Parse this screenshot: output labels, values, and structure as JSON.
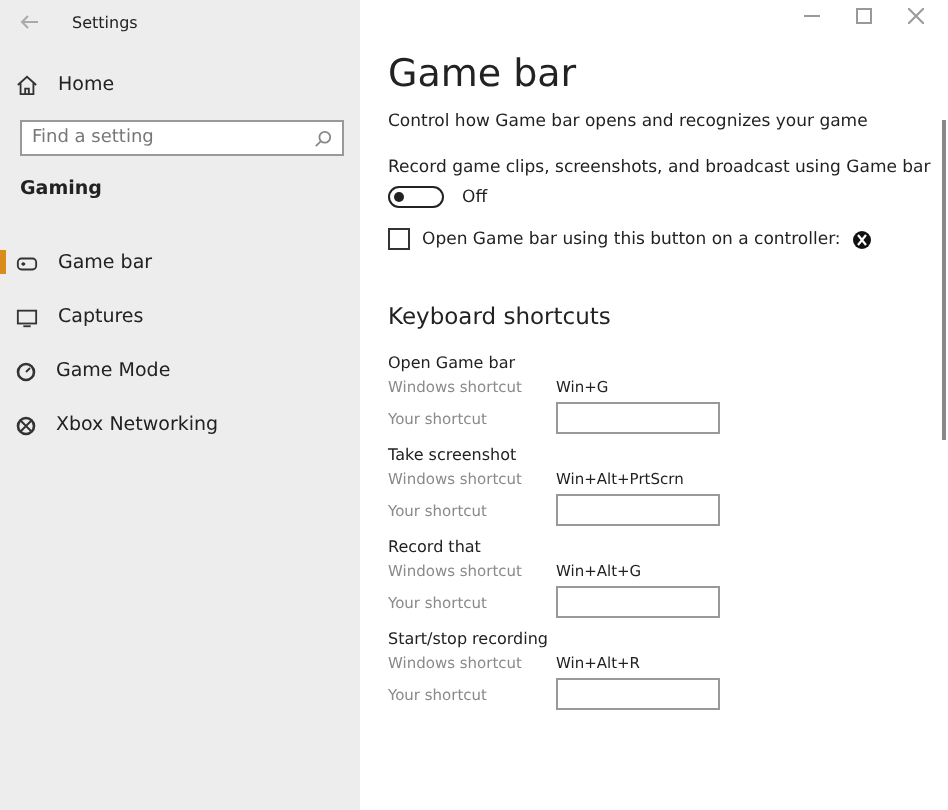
{
  "window": {
    "title": "Settings"
  },
  "sidebar": {
    "home": "Home",
    "search": {
      "placeholder": "Find a setting"
    },
    "section": "Gaming",
    "items": [
      {
        "label": "Game bar",
        "selected": true
      },
      {
        "label": "Captures",
        "selected": false
      },
      {
        "label": "Game Mode",
        "selected": false
      },
      {
        "label": "Xbox Networking",
        "selected": false
      }
    ]
  },
  "page": {
    "title": "Game bar",
    "description": "Control how Game bar opens and recognizes your game",
    "record": {
      "label": "Record game clips, screenshots, and broadcast using Game bar",
      "on": false,
      "state_text": "Off"
    },
    "controller": {
      "label": "Open Game bar using this button on a controller:",
      "checked": false
    },
    "shortcuts_title": "Keyboard shortcuts",
    "shortcuts": [
      {
        "name": "Open Game bar",
        "windows_label": "Windows shortcut",
        "windows_value": "Win+G",
        "your_label": "Your shortcut"
      },
      {
        "name": "Take screenshot",
        "windows_label": "Windows shortcut",
        "windows_value": "Win+Alt+PrtScrn",
        "your_label": "Your shortcut"
      },
      {
        "name": "Record that",
        "windows_label": "Windows shortcut",
        "windows_value": "Win+Alt+G",
        "your_label": "Your shortcut"
      },
      {
        "name": "Start/stop recording",
        "windows_label": "Windows shortcut",
        "windows_value": "Win+Alt+R",
        "your_label": "Your shortcut"
      }
    ]
  }
}
